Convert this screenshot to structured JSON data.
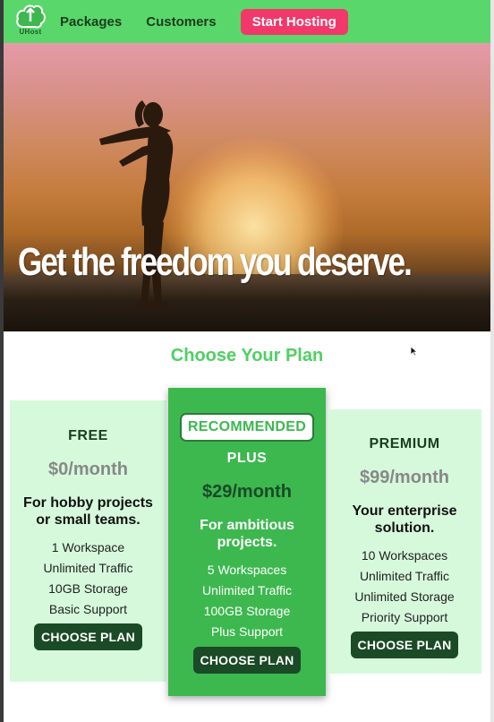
{
  "nav": {
    "logo_text": "UHost",
    "links": [
      "Packages",
      "Customers"
    ],
    "cta_label": "Start Hosting"
  },
  "hero": {
    "headline": "Get the freedom you deserve."
  },
  "plans_section": {
    "title": "Choose Your Plan"
  },
  "plans": [
    {
      "tier": "FREE",
      "price": "$0/month",
      "tagline": "For hobby projects or small teams.",
      "features": [
        "1 Workspace",
        "Unlimited Traffic",
        "10GB Storage",
        "Basic Support"
      ],
      "button": "CHOOSE PLAN"
    },
    {
      "badge": "RECOMMENDED",
      "tier": "PLUS",
      "price": "$29/month",
      "tagline": "For ambitious projects.",
      "features": [
        "5 Workspaces",
        "Unlimited Traffic",
        "100GB Storage",
        "Plus Support"
      ],
      "button": "CHOOSE PLAN"
    },
    {
      "tier": "PREMIUM",
      "price": "$99/month",
      "tagline": "Your enterprise solution.",
      "features": [
        "10 Workspaces",
        "Unlimited Traffic",
        "Unlimited Storage",
        "Priority Support"
      ],
      "button": "CHOOSE PLAN"
    }
  ],
  "colors": {
    "nav_green": "#5ad76a",
    "cta_pink": "#f2386b",
    "title_green": "#4fd062",
    "card_light": "#d6f9dc",
    "card_highlight": "#3cb84f",
    "button_dark": "#1a4a26"
  },
  "icons": {
    "logo": "cloud-logo-icon",
    "cursor": "mouse-pointer-icon"
  }
}
